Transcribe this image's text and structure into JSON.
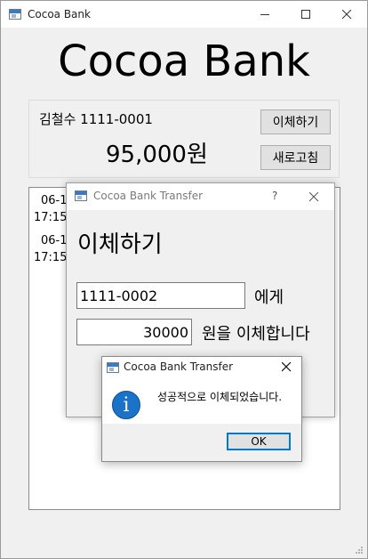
{
  "main_window": {
    "title": "Cocoa Bank",
    "heading": "Cocoa Bank",
    "account_owner": "김철수 1111-0001",
    "balance": "95,000원",
    "transfer_button": "이체하기",
    "refresh_button": "새로고침",
    "history": [
      {
        "line1": "06-1",
        "line2": "17:15:"
      },
      {
        "line1": "06-1",
        "line2": "17:15:"
      }
    ]
  },
  "transfer_dialog": {
    "title": "Cocoa Bank Transfer",
    "help": "?",
    "heading": "이체하기",
    "account_value": "1111-0002",
    "account_suffix": "에게",
    "amount_value": "30000",
    "amount_suffix": "원을 이체합니다"
  },
  "message_box": {
    "title": "Cocoa Bank Transfer",
    "message": "성공적으로 이체되었습니다.",
    "ok_button": "OK",
    "icon": "info-icon"
  },
  "colors": {
    "accent_focus": "#0078d7",
    "info_icon": "#1a73c9"
  }
}
